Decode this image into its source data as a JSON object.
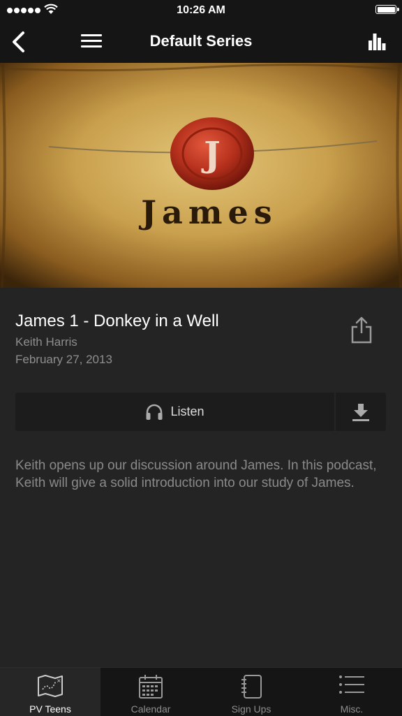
{
  "status_bar": {
    "time": "10:26 AM"
  },
  "nav": {
    "title": "Default Series"
  },
  "hero": {
    "seal_letter": "J",
    "word": "James"
  },
  "episode": {
    "title": "James 1 - Donkey in a Well",
    "author": "Keith Harris",
    "date": "February 27, 2013",
    "listen_label": "Listen",
    "description": "Keith opens up our discussion around James.  In this podcast, Keith will give a solid introduction into our study of James."
  },
  "tabs": [
    {
      "label": "PV Teens",
      "icon": "map-icon",
      "active": true
    },
    {
      "label": "Calendar",
      "icon": "calendar-icon",
      "active": false
    },
    {
      "label": "Sign Ups",
      "icon": "notebook-icon",
      "active": false
    },
    {
      "label": "Misc.",
      "icon": "list-icon",
      "active": false
    }
  ],
  "colors": {
    "background": "#242424",
    "bar": "#151515",
    "muted_text": "#8e8e8e"
  }
}
